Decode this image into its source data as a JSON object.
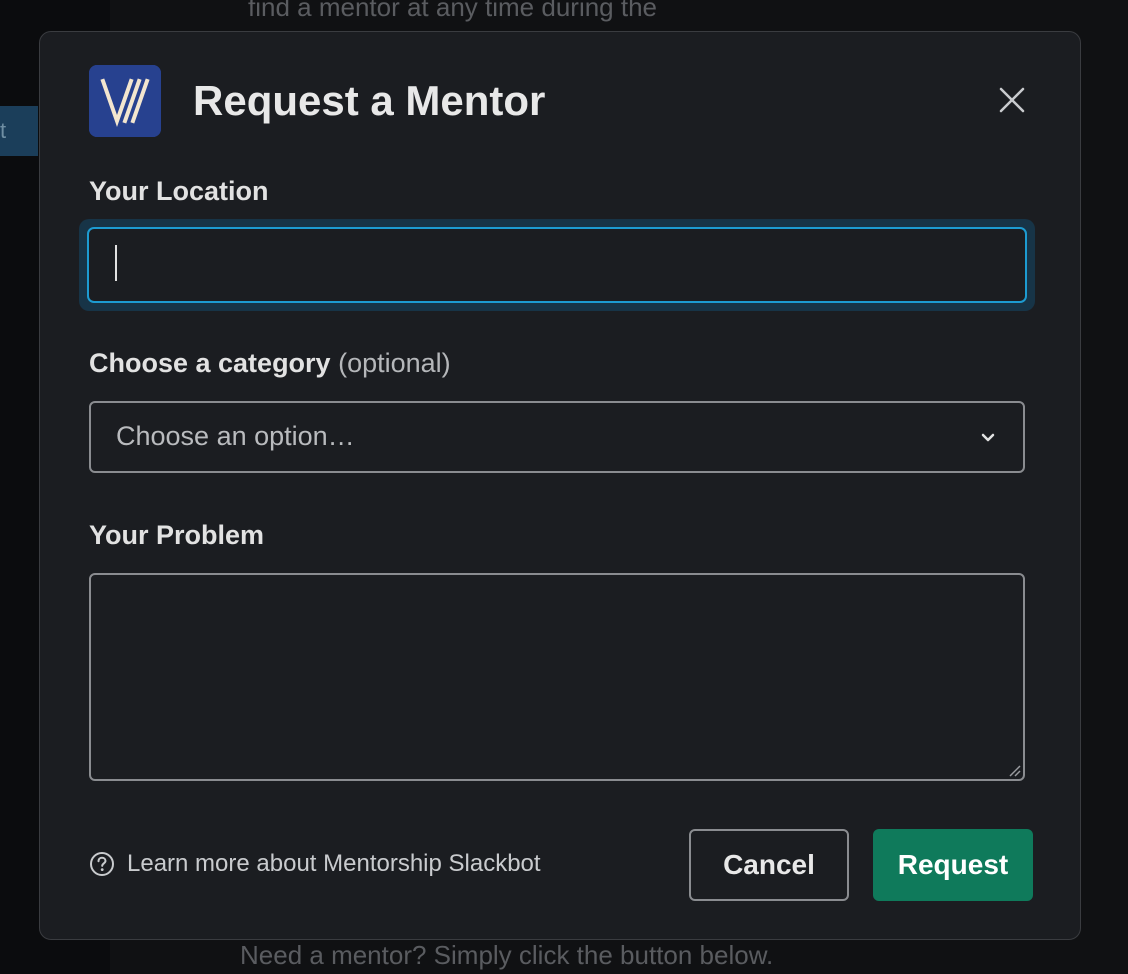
{
  "background": {
    "top_text": "find a mentor at any time during the",
    "bottom_text": "Need a mentor? Simply click the button below.",
    "sidebar_active_fragment": "t"
  },
  "modal": {
    "title": "Request a Mentor",
    "app_icon": "mentorship-logo",
    "close_icon": "close-icon"
  },
  "fields": {
    "location": {
      "label": "Your Location",
      "value": "",
      "placeholder": ""
    },
    "category": {
      "label": "Choose a category",
      "optional": "(optional)",
      "placeholder": "Choose an option…",
      "icon": "chevron-down-icon"
    },
    "problem": {
      "label": "Your Problem",
      "value": ""
    }
  },
  "footer": {
    "learn_more": "Learn more about Mentorship Slackbot",
    "help_icon": "question-circle-icon",
    "cancel_label": "Cancel",
    "request_label": "Request"
  },
  "colors": {
    "modal_bg": "#1b1d21",
    "focus_border": "#1d9bd1",
    "primary_button": "#0f7a5b",
    "app_icon_bg": "#27418f"
  }
}
